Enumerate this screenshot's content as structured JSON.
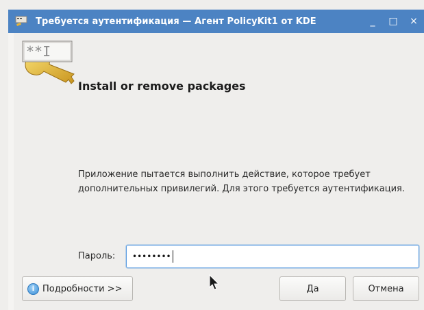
{
  "window": {
    "title": "Требуется аутентификация — Агент PolicyKit1 от KDE",
    "minimize_glyph": "_",
    "maximize_glyph": "□",
    "close_glyph": "×"
  },
  "dialog": {
    "icon_text": "**I",
    "heading": "Install or remove packages",
    "description": "Приложение пытается выполнить действие, которое требует дополнительных привилегий. Для этого требуется аутентификация.",
    "password_label": "Пароль:",
    "password_value": "••••••••"
  },
  "buttons": {
    "details": "Подробности >>",
    "details_icon": "i",
    "yes": "Да",
    "cancel": "Отмена"
  },
  "colors": {
    "titlebar": "#4c83c3",
    "focus": "#5a9be0"
  },
  "icons": [
    "window-app-icon",
    "key-password-icon",
    "info-icon",
    "mouse-pointer-icon"
  ]
}
